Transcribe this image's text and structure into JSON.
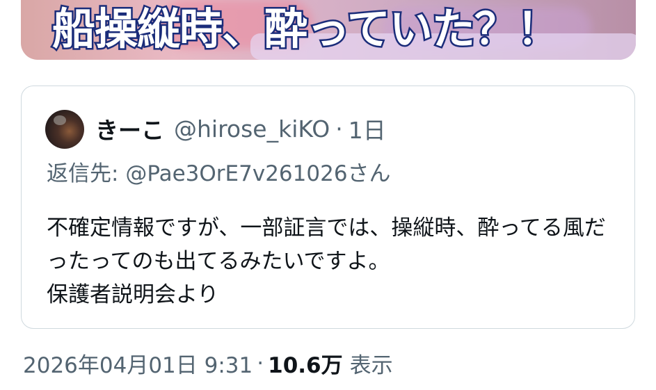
{
  "media": {
    "headline": "船操縦時、酔っていた？！"
  },
  "quote": {
    "author_name": "きーこ",
    "author_handle": "@hirose_kiKO",
    "separator": "·",
    "age": "1日",
    "reply_to_prefix": "返信先:",
    "reply_to_handle": "@Pae3OrE7v261026さん",
    "text": "不確定情報ですが、一部証言では、操縦時、酔ってる風だったってのも出てるみたいですよ。\n保護者説明会より"
  },
  "meta": {
    "timestamp": "2026年04月01日 9:31",
    "separator": "·",
    "views_count": "10.6万",
    "views_label": "表示"
  }
}
